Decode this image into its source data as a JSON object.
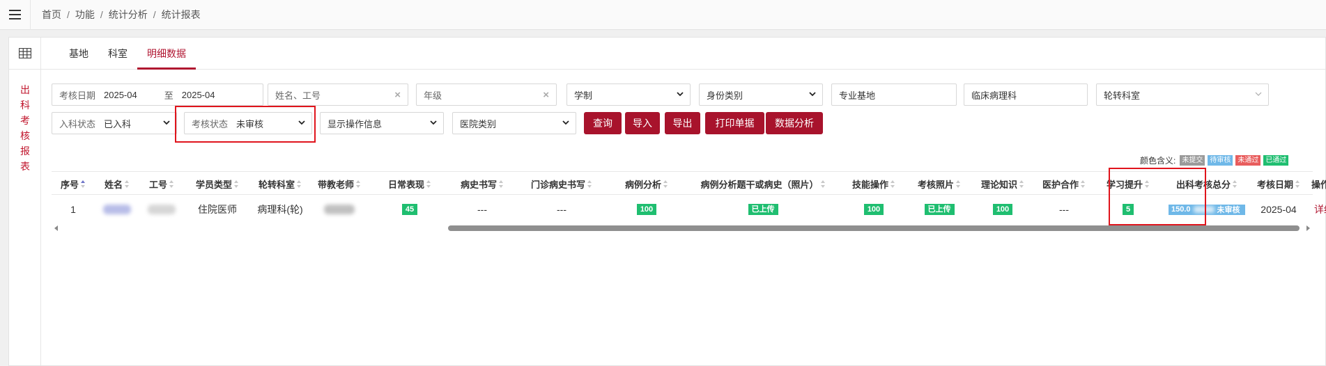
{
  "breadcrumb": [
    "首页",
    "功能",
    "统计分析",
    "统计报表"
  ],
  "sidebar_title": [
    "出",
    "科",
    "考",
    "核",
    "报",
    "表"
  ],
  "tabs": [
    "基地",
    "科室",
    "明细数据"
  ],
  "filters": {
    "date_label": "考核日期",
    "date_from": "2025-04",
    "date_to_label": "至",
    "date_to": "2025-04",
    "name_placeholder": "姓名、工号",
    "grade_placeholder": "年级",
    "school_system": "学制",
    "identity_type": "身份类别",
    "major_base": "专业基地",
    "pathology": "临床病理科",
    "rotation_dept": "轮转科室",
    "entry_status_label": "入科状态",
    "entry_status": "已入科",
    "exam_status_label": "考核状态",
    "exam_status": "未审核",
    "show_ops": "显示操作信息",
    "hospital_type": "医院类别"
  },
  "buttons": [
    "查询",
    "导入",
    "导出",
    "打印单据",
    "数据分析"
  ],
  "legend": {
    "label": "颜色含义:",
    "items": [
      {
        "text": "未提交",
        "color": "#9a9a9a"
      },
      {
        "text": "待审核",
        "color": "#6fb8e8"
      },
      {
        "text": "未通过",
        "color": "#e85d5d"
      },
      {
        "text": "已通过",
        "color": "#1fbe70"
      }
    ]
  },
  "table": {
    "headers": [
      "序号",
      "姓名",
      "工号",
      "学员类型",
      "轮转科室",
      "带教老师",
      "日常表现",
      "病史书写",
      "门诊病史书写",
      "病例分析",
      "病例分析题干或病史（照片）",
      "技能操作",
      "考核照片",
      "理论知识",
      "医护合作",
      "学习提升",
      "出科考核总分",
      "考核日期",
      "操作"
    ],
    "row": {
      "index": "1",
      "student_type": "住院医师",
      "rotation_dept": "病理科(轮)",
      "daily": "45",
      "history": "---",
      "outpatient_history": "---",
      "case_analysis": "100",
      "case_photo": "已上传",
      "skills": "100",
      "exam_photo": "已上传",
      "theory": "100",
      "cooperation": "---",
      "improvement": "5",
      "total_score": "150.0",
      "total_status": "未审核",
      "exam_date": "2025-04",
      "action": "详细"
    }
  },
  "colors": {
    "brand_red": "#a8132c",
    "highlight_box": "#e0141c",
    "passed_green": "#1fbe70",
    "pending_blue": "#6fb8e8"
  }
}
